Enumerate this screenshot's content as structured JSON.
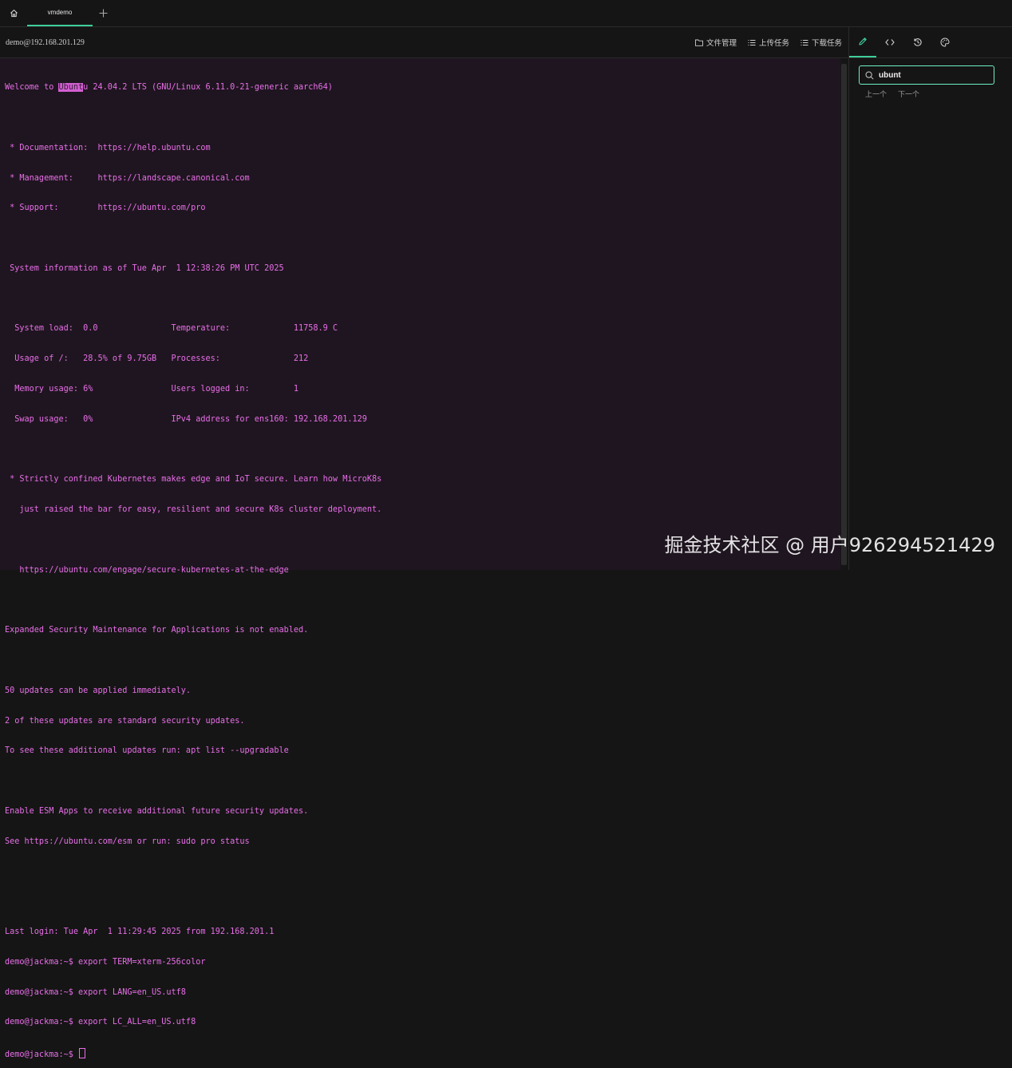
{
  "tabs": [
    {
      "label": "vmdemo",
      "active": true
    }
  ],
  "toolbar": {
    "host": "demo@192.168.201.129",
    "file_manager": "文件管理",
    "upload_tasks": "上传任务",
    "download_tasks": "下载任务"
  },
  "search": {
    "value": "ubunt",
    "prev_label": "上一个",
    "next_label": "下一个"
  },
  "terminal": {
    "welcome_prefix": "Welcome to ",
    "welcome_highlight": "Ubunt",
    "welcome_suffix": "u 24.04.2 LTS (GNU/Linux 6.11.0-21-generic aarch64)",
    "lines": [
      "",
      " * Documentation:  https://help.ubuntu.com",
      " * Management:     https://landscape.canonical.com",
      " * Support:        https://ubuntu.com/pro",
      "",
      " System information as of Tue Apr  1 12:38:26 PM UTC 2025",
      "",
      "  System load:  0.0               Temperature:             11758.9 C",
      "  Usage of /:   28.5% of 9.75GB   Processes:               212",
      "  Memory usage: 6%                Users logged in:         1",
      "  Swap usage:   0%                IPv4 address for ens160: 192.168.201.129",
      "",
      " * Strictly confined Kubernetes makes edge and IoT secure. Learn how MicroK8s",
      "   just raised the bar for easy, resilient and secure K8s cluster deployment.",
      "",
      "   https://ubuntu.com/engage/secure-kubernetes-at-the-edge",
      "",
      "Expanded Security Maintenance for Applications is not enabled.",
      "",
      "50 updates can be applied immediately.",
      "2 of these updates are standard security updates.",
      "To see these additional updates run: apt list --upgradable",
      "",
      "Enable ESM Apps to receive additional future security updates.",
      "See https://ubuntu.com/esm or run: sudo pro status",
      "",
      "",
      "Last login: Tue Apr  1 11:29:45 2025 from 192.168.201.1",
      "demo@jackma:~$ export TERM=xterm-256color",
      "demo@jackma:~$ export LANG=en_US.utf8",
      "demo@jackma:~$ export LC_ALL=en_US.utf8"
    ],
    "prompt": "demo@jackma:~$ "
  },
  "watermark": "掘金技术社区 @ 用户926294521429",
  "colors": {
    "accent": "#3ecf9b",
    "terminal_bg": "#1f1520",
    "terminal_fg": "#e86fe8",
    "highlight": "#d35fd3"
  },
  "icons": {
    "home": "home-icon",
    "add": "plus-icon",
    "folder": "folder-icon",
    "upload_list": "list-icon",
    "download_list": "list-icon",
    "edit": "pencil-icon",
    "code": "code-icon",
    "history": "history-icon",
    "palette": "palette-icon",
    "search": "search-icon"
  }
}
